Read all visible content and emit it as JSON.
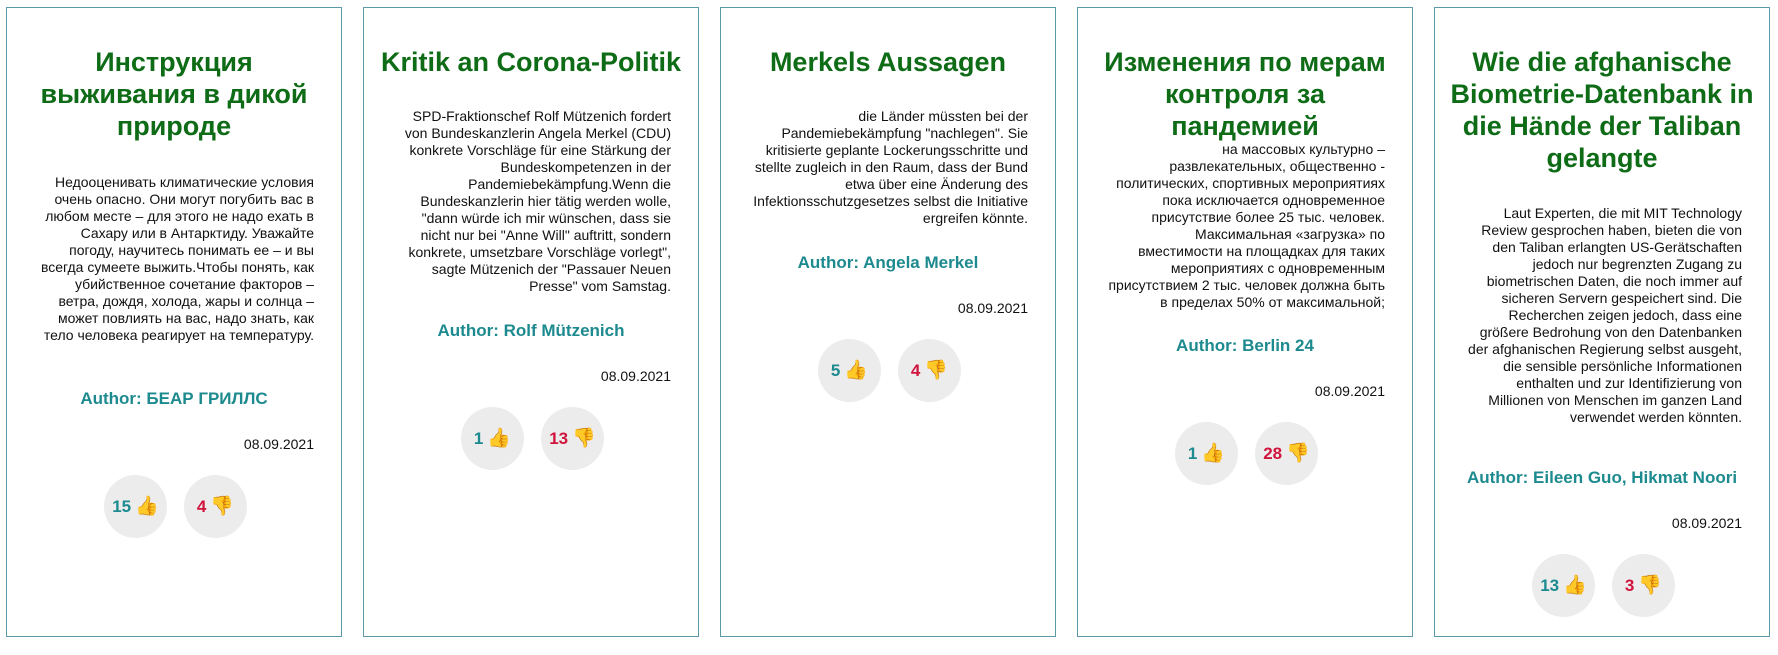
{
  "cards": [
    {
      "title": "Инструкция выживания в дикой природе",
      "text": "Недооценивать климатические условия очень опасно. Они могут погубить вас в любом месте – для этого не надо ехать в Сахару или в Антарктиду. Уважайте погоду, научитесь понимать ее – и вы всегда сумеете выжить.Чтобы понять, как убийственное сочетание факторов – ветра, дождя, холода, жары и солнца – может повлиять на вас, надо знать, как тело человека реагирует на температуру.",
      "author": "Author: БЕАР ГРИЛЛС",
      "date": "08.09.2021",
      "likes": "15",
      "dislikes": "4",
      "like_icon": "thumbs-up-icon",
      "dislike_icon": "thumbs-down-icon"
    },
    {
      "title": "Kritik an Corona-Politik",
      "text": "SPD-Fraktionschef Rolf Mützenich fordert von Bundeskanzlerin Angela Merkel (CDU) konkrete Vorschläge für eine Stärkung der Bundeskompetenzen in der Pandemiebekämpfung.Wenn die Bundeskanzlerin hier tätig werden wolle, \"dann würde ich mir wünschen, dass sie nicht nur bei \"Anne Will\" auftritt, sondern konkrete, umsetzbare Vorschläge vorlegt\", sagte Mützenich der \"Passauer Neuen Presse\" vom Samstag.",
      "author": "Author: Rolf Mützenich",
      "date": "08.09.2021",
      "likes": "1",
      "dislikes": "13",
      "like_icon": "thumbs-up-icon",
      "dislike_icon": "thumbs-down-icon"
    },
    {
      "title": "Merkels Aussagen",
      "text": "die Länder müssten bei der Pandemiebekämpfung \"nachlegen\". Sie kritisierte geplante Lockerungsschritte und stellte zugleich in den Raum, dass der Bund etwa über eine Änderung des Infektionsschutzgesetzes selbst die Initiative ergreifen könnte.",
      "author": "Author: Angela Merkel",
      "date": "08.09.2021",
      "likes": "5",
      "dislikes": "4",
      "like_icon": "thumbs-up-icon",
      "dislike_icon": "thumbs-down-icon"
    },
    {
      "title": "Изменения по мерам контроля за пандемией",
      "text": "на массовых культурно – развлекательных, общественно - политических, спортивных мероприятиях пока исключается одновременное присутствие более 25 тыс. человек. Максимальная «загрузка» по вместимости на площадках для таких мероприятиях с одновременным присутствием 2 тыс. человек должна быть в пределах 50% от максимальной;",
      "author": "Author: Berlin 24",
      "date": "08.09.2021",
      "likes": "1",
      "dislikes": "28",
      "like_icon": "thumbs-up-icon",
      "dislike_icon": "thumbs-down-icon"
    },
    {
      "title": "Wie die afghanische Biometrie-Datenbank in die Hände der Taliban gelangte",
      "text": "Laut Experten, die mit MIT Technology Review gesprochen haben, bieten die von den Taliban erlangten US-Gerätschaften jedoch nur begrenzten Zugang zu biometrischen Daten, die noch immer auf sicheren Servern gespeichert sind. Die Recherchen zeigen jedoch, dass eine größere Bedrohung von den Datenbanken der afghanischen Regierung selbst ausgeht, die sensible persönliche Informationen enthalten und zur Identifizierung von Millionen von Menschen im ganzen Land verwendet werden könnten.",
      "author": "Author: Eileen Guo, Hikmat Noori",
      "date": "08.09.2021",
      "likes": "13",
      "dislikes": "3",
      "like_icon": "thumbs-up-icon",
      "dislike_icon": "thumbs-down-icon"
    }
  ],
  "colors": {
    "title": "#0e6b16",
    "author": "#1c8a8e",
    "likes": "#1c8a8e",
    "dislikes": "#d0143c",
    "border": "#5b9aa6",
    "vote_bg": "#ececec"
  }
}
